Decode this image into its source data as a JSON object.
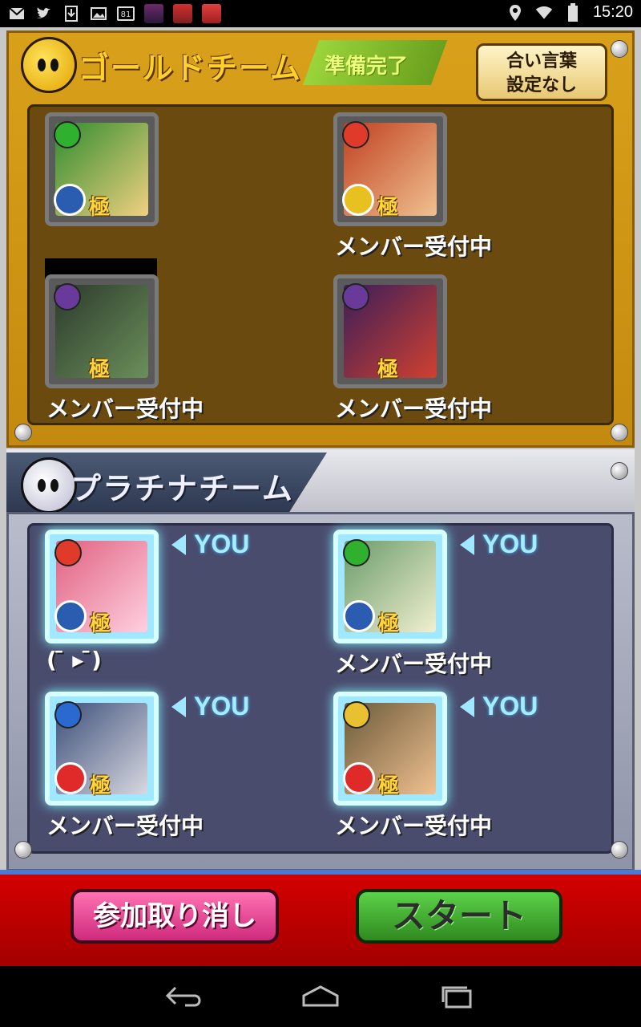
{
  "status_bar": {
    "time": "15:20",
    "badge_number": "81",
    "icons": [
      "gmail-icon",
      "twitter-icon",
      "download-icon",
      "image-icon",
      "badge-icon",
      "game-thumb-icon",
      "game-thumb-icon",
      "game-thumb-icon",
      "location-icon",
      "wifi-icon",
      "battery-icon"
    ]
  },
  "gold_team": {
    "title": "ゴールドチーム",
    "ready_label": "準備完了",
    "aikotoba_line1": "合い言葉",
    "aikotoba_line2": "設定なし",
    "slots": [
      {
        "label": "",
        "rank": "極",
        "colors": [
          "#2f8c2f",
          "#f0d080"
        ]
      },
      {
        "label": "メンバー受付中",
        "rank": "極",
        "colors": [
          "#c04020",
          "#f0c090"
        ]
      },
      {
        "label": "メンバー受付中",
        "rank": "極",
        "colors": [
          "#2c3a2c",
          "#6b8f5a"
        ]
      },
      {
        "label": "メンバー受付中",
        "rank": "極",
        "colors": [
          "#3a1e5a",
          "#d04030"
        ]
      }
    ]
  },
  "platinum_team": {
    "title": "プラチナチーム",
    "you_label": "YOU",
    "slots": [
      {
        "label": "(  ̄ ▸ ̄)",
        "rank": "極",
        "colors": [
          "#e06080",
          "#ffd0e0"
        ]
      },
      {
        "label": "メンバー受付中",
        "rank": "極",
        "colors": [
          "#6a9a6a",
          "#f0f0d0"
        ]
      },
      {
        "label": "メンバー受付中",
        "rank": "極",
        "colors": [
          "#3c4f7a",
          "#d8d8e0"
        ]
      },
      {
        "label": "メンバー受付中",
        "rank": "極",
        "colors": [
          "#6a5a3a",
          "#f0c090"
        ]
      }
    ]
  },
  "buttons": {
    "cancel_label": "参加取り消し",
    "start_label": "スタート"
  },
  "theme": {
    "gold": "#d9a11a",
    "platinum": "#4a4c6e",
    "red": "#d40000",
    "cancel": "#e0488e",
    "start": "#3fa82e"
  }
}
